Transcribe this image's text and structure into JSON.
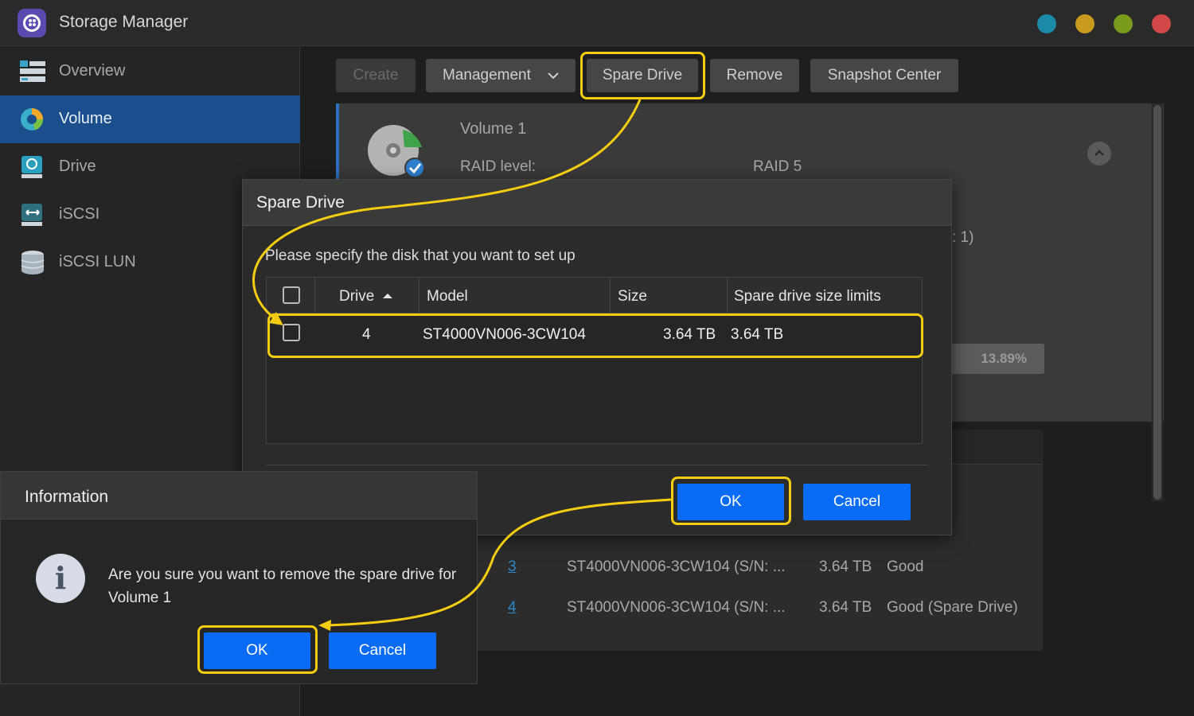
{
  "window": {
    "title": "Storage Manager",
    "buttons": [
      "#1a8aa6",
      "#c89a1e",
      "#7a9c1c",
      "#d24848"
    ]
  },
  "sidebar": {
    "items": [
      {
        "label": "Overview",
        "icon": "overview-icon",
        "active": false
      },
      {
        "label": "Volume",
        "icon": "volume-icon",
        "active": true
      },
      {
        "label": "Drive",
        "icon": "drive-icon",
        "active": false
      },
      {
        "label": "iSCSI",
        "icon": "iscsi-icon",
        "active": false
      },
      {
        "label": "iSCSI LUN",
        "icon": "iscsi-lun-icon",
        "active": false
      }
    ]
  },
  "toolbar": {
    "create": "Create",
    "management": "Management",
    "spare_drive": "Spare Drive",
    "remove": "Remove",
    "snapshot_center": "Snapshot Center"
  },
  "volume": {
    "title": "Volume 1",
    "raid_label": "RAID level:",
    "raid_value": "RAID 5",
    "partial_text": ": 1)",
    "usage": "13.89%"
  },
  "drives_list": [
    {
      "number": "3",
      "model": "ST4000VN006-3CW104 (S/N: ...",
      "size": "3.64 TB",
      "status": "Good"
    },
    {
      "number": "4",
      "model": "ST4000VN006-3CW104 (S/N: ...",
      "size": "3.64 TB",
      "status": "Good (Spare Drive)"
    }
  ],
  "spare_dialog": {
    "title": "Spare Drive",
    "prompt": "Please specify the disk that you want to set up",
    "columns": [
      "Drive",
      "Model",
      "Size",
      "Spare drive size limits"
    ],
    "rows": [
      {
        "drive": "4",
        "model": "ST4000VN006-3CW104",
        "size": "3.64 TB",
        "limit": "3.64 TB"
      }
    ],
    "ok": "OK",
    "cancel": "Cancel"
  },
  "info_dialog": {
    "title": "Information",
    "icon": "info-icon",
    "message": "Are you sure you want to remove the spare drive for Volume 1",
    "ok": "OK",
    "cancel": "Cancel"
  },
  "colors": {
    "accent": "#0a6cf5",
    "highlight": "#f4cc11",
    "active_nav": "#1a4e8c"
  }
}
